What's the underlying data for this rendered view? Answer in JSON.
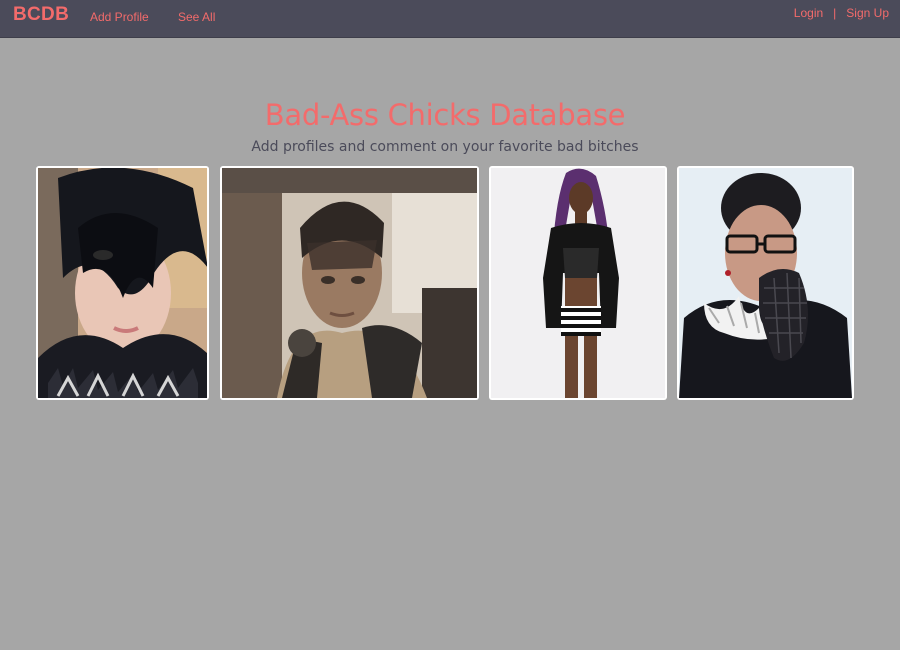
{
  "nav": {
    "brand": "BCDB",
    "add_profile": "Add Profile",
    "see_all": "See All",
    "login": "Login",
    "separator": "|",
    "sign_up": "Sign Up"
  },
  "hero": {
    "title": "Bad-Ass Chicks Database",
    "subtitle": "Add profiles and comment on your favorite bad bitches"
  },
  "colors": {
    "accent": "#f36b6b",
    "navbar": "#4b4b5a",
    "background": "#a6a6a6"
  }
}
